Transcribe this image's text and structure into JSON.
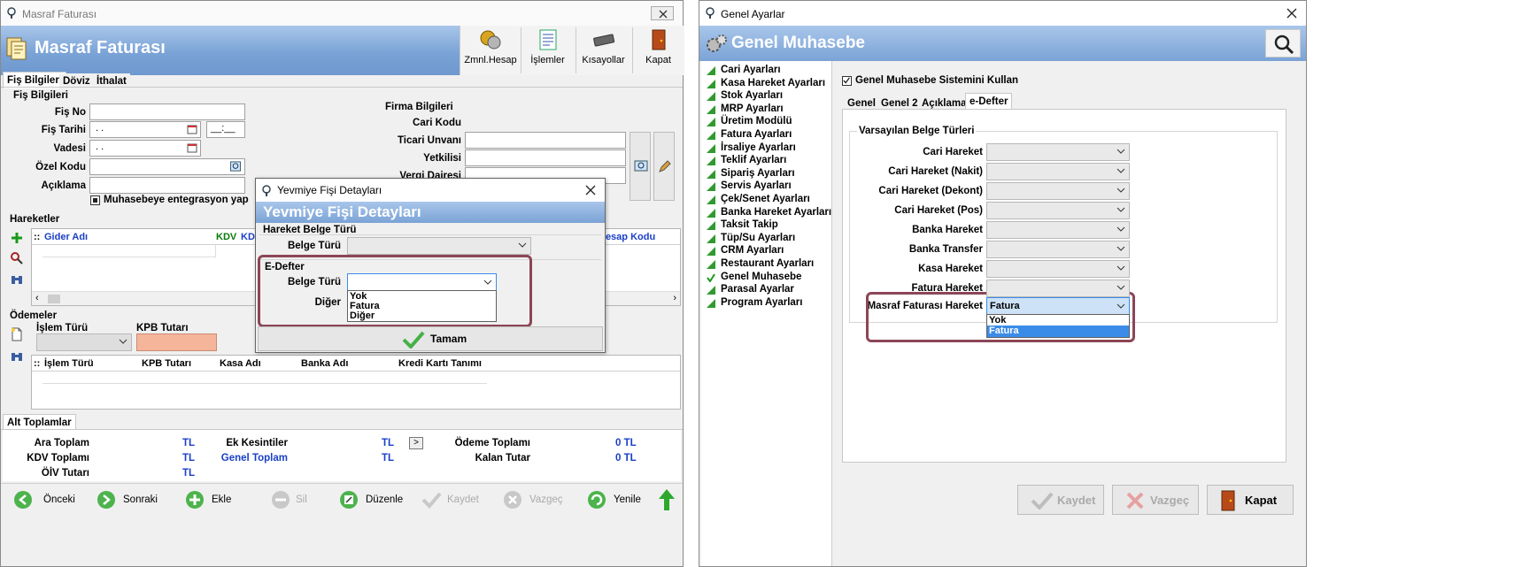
{
  "left_window": {
    "title": "Masraf Faturası",
    "header_title": "Masraf Faturası",
    "toolbar": [
      "Zmnl.Hesap",
      "İşlemler",
      "Kısayollar",
      "Kapat"
    ],
    "tabs": [
      "Fiş Bilgileri",
      "Döviz",
      "İthalat"
    ],
    "fis_bilgileri": {
      "group": "Fiş Bilgileri",
      "fis_no": "Fiş No",
      "fis_tarihi": "Fiş Tarihi",
      "vadesi": "Vadesi",
      "ozel_kodu": "Özel Kodu",
      "aciklama": "Açıklama",
      "date_value": ". .",
      "date_value2": ". .",
      "time_value": "__:__",
      "muhasebe_check": "Muhasebeye entegrasyon yap"
    },
    "firma": {
      "group": "Firma Bilgileri",
      "cari_kodu": "Cari Kodu",
      "ticari_unvani": "Ticari Unvanı",
      "yetkilisi": "Yetkilisi",
      "vergi_dairesi": "Vergi Dairesi"
    },
    "hareketler": {
      "label": "Hareketler",
      "columns": [
        "Gider Adı",
        "KDV",
        "KDV",
        "Hesap Kodu"
      ]
    },
    "odemeler": {
      "label": "Ödemeler",
      "islem_turu": "İşlem Türü",
      "kpb_tutari": "KPB Tutarı",
      "columns": [
        "İşlem Türü",
        "KPB Tutarı",
        "Kasa Adı",
        "Banka Adı",
        "Kredi Kartı Tanımı"
      ]
    },
    "alt_toplamlar": {
      "tab": "Alt Toplamlar",
      "ara_toplam": "Ara Toplam",
      "kdv_toplami": "KDV Toplamı",
      "oiv_tutari": "ÖİV Tutarı",
      "ek_kesintiler": "Ek Kesintiler",
      "genel_toplam": "Genel Toplam",
      "odeme_toplami": "Ödeme Toplamı",
      "kalan_tutar": "Kalan Tutar",
      "tl": "TL",
      "zero_tl": "0 TL",
      "arrow": ">"
    },
    "nav": [
      "Önceki",
      "Sonraki",
      "Ekle",
      "Sil",
      "Düzenle",
      "Kaydet",
      "Vazgeç",
      "Yenile"
    ]
  },
  "yevmiye_dialog": {
    "title": "Yevmiye Fişi Detayları",
    "header_title": "Yevmiye Fişi Detayları",
    "hareket_group": "Hareket Belge Türü",
    "belge_turu": "Belge Türü",
    "edefter_group": "E-Defter",
    "belge_turu2": "Belge Türü",
    "diger": "Diğer",
    "options": [
      "Yok",
      "Fatura",
      "Diğer"
    ],
    "ok_button": "Tamam"
  },
  "right_window": {
    "title": "Genel Ayarlar",
    "header_title": "Genel Muhasebe",
    "tree": [
      "Cari Ayarları",
      "Kasa Hareket Ayarları",
      "Stok Ayarları",
      "MRP Ayarları",
      "Üretim Modülü",
      "Fatura Ayarları",
      "İrsaliye Ayarları",
      "Teklif Ayarları",
      "Sipariş Ayarları",
      "Servis Ayarları",
      "Çek/Senet Ayarları",
      "Banka Hareket Ayarları",
      "Taksit Takip",
      "Tüp/Su Ayarları",
      "CRM Ayarları",
      "Restaurant Ayarları",
      "Genel Muhasebe",
      "Parasal Ayarlar",
      "Program Ayarları"
    ],
    "checkbox_label": "Genel Muhasebe Sistemini Kullan",
    "tabs": [
      "Genel",
      "Genel 2",
      "Açıklama",
      "e-Defter"
    ],
    "group": "Varsayılan Belge Türleri",
    "rows": [
      "Cari Hareket",
      "Cari Hareket (Nakit)",
      "Cari Hareket (Dekont)",
      "Cari Hareket (Pos)",
      "Banka Hareket",
      "Banka Transfer",
      "Kasa Hareket",
      "Fatura Hareket"
    ],
    "masraf_label": "Masraf Faturası Hareket",
    "masraf_value": "Fatura",
    "options": [
      "Yok",
      "Fatura"
    ],
    "buttons": [
      "Kaydet",
      "Vazgeç",
      "Kapat"
    ]
  },
  "colors": {
    "header_blue": "#7aa3d6",
    "highlight_border": "#8c4657",
    "kpb_field": "#f5b59a",
    "selection": "#3b8be8"
  }
}
